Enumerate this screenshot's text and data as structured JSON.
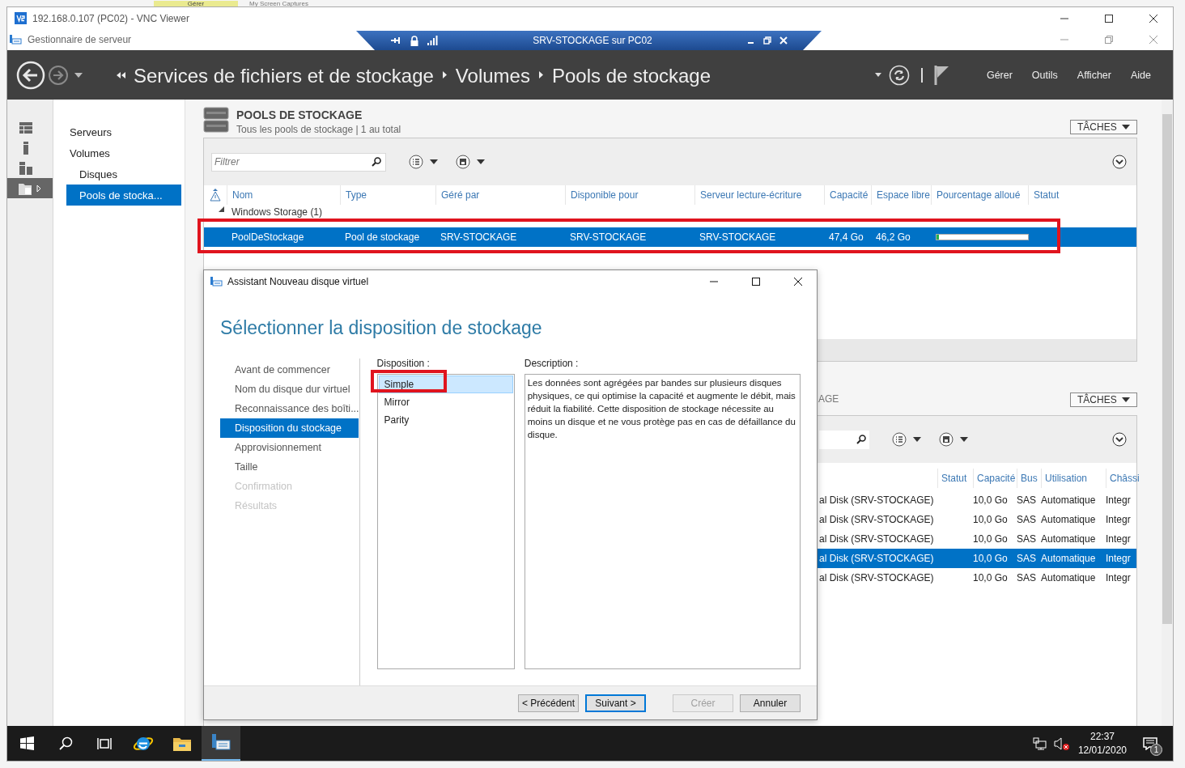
{
  "background": {
    "tab": "Gérer",
    "folder": "My Screen Captures"
  },
  "vnc_window": {
    "title": "192.168.0.107 (PC02) - VNC Viewer"
  },
  "vnc_toolbar": {
    "title": "SRV-STOCKAGE sur PC02"
  },
  "app": {
    "title": "Gestionnaire de serveur"
  },
  "header": {
    "breadcrumb": [
      "Services de fichiers et de stockage",
      "Volumes",
      "Pools de stockage"
    ],
    "menu": [
      "Gérer",
      "Outils",
      "Afficher",
      "Aide"
    ]
  },
  "rail": [
    {
      "kind": "dashboard",
      "selected": false
    },
    {
      "kind": "server",
      "selected": false
    },
    {
      "kind": "servers",
      "selected": false
    },
    {
      "kind": "files",
      "selected": true
    }
  ],
  "nav": [
    {
      "label": "Serveurs",
      "selected": false
    },
    {
      "label": "Volumes",
      "selected": false,
      "children": [
        {
          "label": "Disques",
          "selected": false
        },
        {
          "label": "Pools de stocka...",
          "selected": true
        }
      ]
    }
  ],
  "pools": {
    "title": "POOLS DE STOCKAGE",
    "subtitle": "Tous les pools de stockage | 1 au total",
    "tasks": "TÂCHES",
    "filter_placeholder": "Filtrer",
    "columns": [
      "Nom",
      "Type",
      "Géré par",
      "Disponible pour",
      "Serveur lecture-écriture",
      "Capacité",
      "Espace libre",
      "Pourcentage alloué",
      "Statut"
    ],
    "groups": [
      {
        "label": "Windows Storage (1)",
        "expanded": true,
        "rows": [
          {
            "cells": [
              "PoolDeStockage",
              "Pool de stockage",
              "SRV-STOCKAGE",
              "SRV-STOCKAGE",
              "SRV-STOCKAGE",
              "47,4 Go",
              "46,2 Go"
            ],
            "level": 0.025,
            "selected": true
          }
        ]
      }
    ]
  },
  "disks": {
    "title": "AGE",
    "tasks": "TÂCHES",
    "columns": [
      "Statut",
      "Capacité",
      "Bus",
      "Utilisation",
      "Châssi"
    ],
    "rows": [
      {
        "cells": [
          "al Disk (SRV-STOCKAGE)",
          "10,0 Go",
          "SAS",
          "Automatique",
          "Integr"
        ],
        "selected": false
      },
      {
        "cells": [
          "al Disk (SRV-STOCKAGE)",
          "10,0 Go",
          "SAS",
          "Automatique",
          "Integr"
        ],
        "selected": false
      },
      {
        "cells": [
          "al Disk (SRV-STOCKAGE)",
          "10,0 Go",
          "SAS",
          "Automatique",
          "Integr"
        ],
        "selected": false
      },
      {
        "cells": [
          "al Disk (SRV-STOCKAGE)",
          "10,0 Go",
          "SAS",
          "Automatique",
          "Integr"
        ],
        "selected": true
      },
      {
        "cells": [
          "al Disk (SRV-STOCKAGE)",
          "10,0 Go",
          "SAS",
          "Automatique",
          "Integr"
        ],
        "selected": false
      }
    ]
  },
  "dialog": {
    "title": "Assistant Nouveau disque virtuel",
    "heading": "Sélectionner la disposition de stockage",
    "steps": [
      {
        "label": "Avant de commencer",
        "selected": false,
        "disabled": false
      },
      {
        "label": "Nom du disque dur virtuel",
        "selected": false,
        "disabled": false
      },
      {
        "label": "Reconnaissance des boîti...",
        "selected": false,
        "disabled": false
      },
      {
        "label": "Disposition du stockage",
        "selected": true,
        "disabled": false
      },
      {
        "label": "Approvisionnement",
        "selected": false,
        "disabled": false
      },
      {
        "label": "Taille",
        "selected": false,
        "disabled": false
      },
      {
        "label": "Confirmation",
        "selected": false,
        "disabled": true
      },
      {
        "label": "Résultats",
        "selected": false,
        "disabled": true
      }
    ],
    "layout_label": "Disposition :",
    "layouts": [
      {
        "label": "Simple",
        "selected": true
      },
      {
        "label": "Mirror",
        "selected": false
      },
      {
        "label": "Parity",
        "selected": false
      }
    ],
    "description_label": "Description :",
    "description": "Les données sont agrégées par bandes sur plusieurs disques physiques, ce qui optimise la capacité et augmente le débit, mais réduit la fiabilité. Cette disposition de stockage nécessite au moins un disque et ne vous protège pas en cas de défaillance du disque.",
    "buttons": [
      {
        "label": "< Précédent",
        "default": false,
        "disabled": false
      },
      {
        "label": "Suivant >",
        "default": true,
        "disabled": false
      },
      {
        "label": "Créer",
        "default": false,
        "disabled": true
      },
      {
        "label": "Annuler",
        "default": false,
        "disabled": false
      }
    ]
  },
  "taskbar": {
    "items": [
      {
        "kind": "start",
        "selected": false
      },
      {
        "kind": "search",
        "selected": false
      },
      {
        "kind": "taskview",
        "selected": false
      },
      {
        "kind": "browser",
        "selected": false
      },
      {
        "kind": "folder",
        "selected": false
      },
      {
        "kind": "server-manager",
        "selected": true
      }
    ],
    "time": "22:37",
    "date": "12/01/2020",
    "notifications": "1"
  }
}
